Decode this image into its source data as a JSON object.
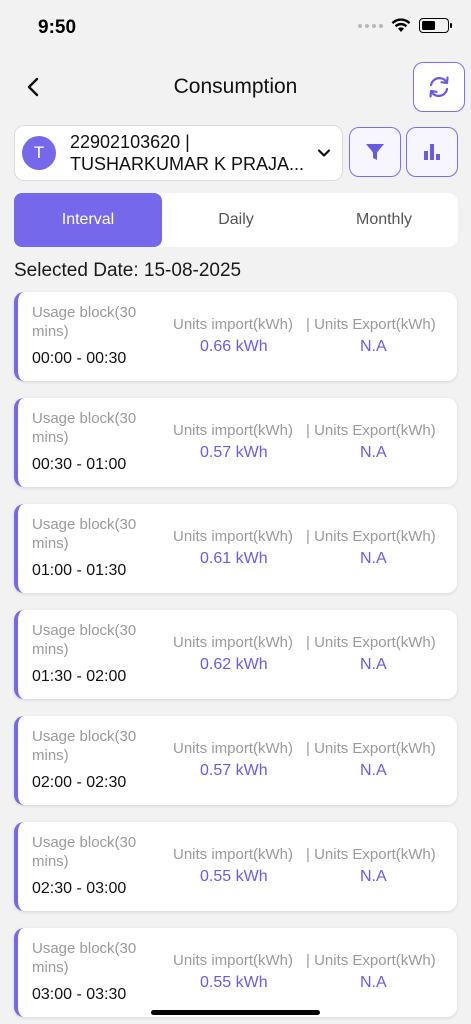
{
  "status_bar": {
    "time": "9:50"
  },
  "header": {
    "title": "Consumption"
  },
  "account": {
    "avatar_letter": "T",
    "line1": "22902103620 |",
    "line2": "TUSHARKUMAR K PRAJA..."
  },
  "tabs": [
    {
      "label": "Interval",
      "active": true
    },
    {
      "label": "Daily",
      "active": false
    },
    {
      "label": "Monthly",
      "active": false
    }
  ],
  "selected_date": "Selected Date: 15-08-2025",
  "card_labels": {
    "usage_block": "Usage block(30 mins)",
    "import": "Units import(kWh)",
    "export": "| Units Export(kWh)"
  },
  "intervals": [
    {
      "time": "00:00 - 00:30",
      "import": "0.66 kWh",
      "export": "N.A"
    },
    {
      "time": "00:30 - 01:00",
      "import": "0.57 kWh",
      "export": "N.A"
    },
    {
      "time": "01:00 - 01:30",
      "import": "0.61 kWh",
      "export": "N.A"
    },
    {
      "time": "01:30 - 02:00",
      "import": "0.62 kWh",
      "export": "N.A"
    },
    {
      "time": "02:00 - 02:30",
      "import": "0.57 kWh",
      "export": "N.A"
    },
    {
      "time": "02:30 - 03:00",
      "import": "0.55 kWh",
      "export": "N.A"
    },
    {
      "time": "03:00 - 03:30",
      "import": "0.55 kWh",
      "export": "N.A"
    }
  ],
  "icons": {
    "back": "chevron-left-icon",
    "refresh": "refresh-icon",
    "dropdown": "chevron-down-icon",
    "filter": "filter-icon",
    "chart": "bar-chart-icon"
  },
  "colors": {
    "accent": "#7568ea",
    "value_text": "#6a5ce0",
    "background": "#f2f2f3"
  }
}
